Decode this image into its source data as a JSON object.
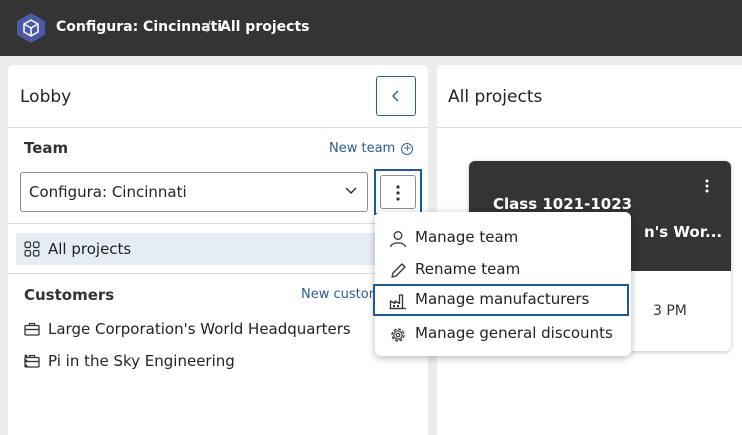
{
  "header": {
    "org": "Configura: Cincinnati",
    "separator": "/",
    "page": "All projects",
    "logo_icon": "configura-logo-icon"
  },
  "lobby": {
    "title": "Lobby",
    "collapse_icon": "chevron-left-icon",
    "team": {
      "label": "Team",
      "new_team_label": "New team",
      "new_team_icon": "plus-circle-icon",
      "selected": "Configura: Cincinnati"
    },
    "all_projects_label": "All projects",
    "customers": {
      "label": "Customers",
      "new_customer_label": "New custom",
      "items": [
        {
          "name": "Large Corporation's World Headquarters",
          "icon": "briefcase-icon"
        },
        {
          "name": "Pi in the Sky Engineering",
          "icon": "briefcase-icon"
        }
      ]
    }
  },
  "team_menu": {
    "items": [
      {
        "label": "Manage team",
        "icon": "person-icon"
      },
      {
        "label": "Rename team",
        "icon": "pencil-icon"
      },
      {
        "label": "Manage manufacturers",
        "icon": "factory-icon"
      },
      {
        "label": "Manage general discounts",
        "icon": "gear-icon"
      }
    ]
  },
  "projects": {
    "title": "All projects",
    "cards": [
      {
        "title": "Class 1021-1023",
        "subtitle": "n's Wor...",
        "time": "3 PM"
      }
    ]
  },
  "colors": {
    "topbar": "#343434",
    "accent": "#2a5c9a",
    "focus_outline": "#1e5a96",
    "selected_row": "#e6ecf4"
  }
}
